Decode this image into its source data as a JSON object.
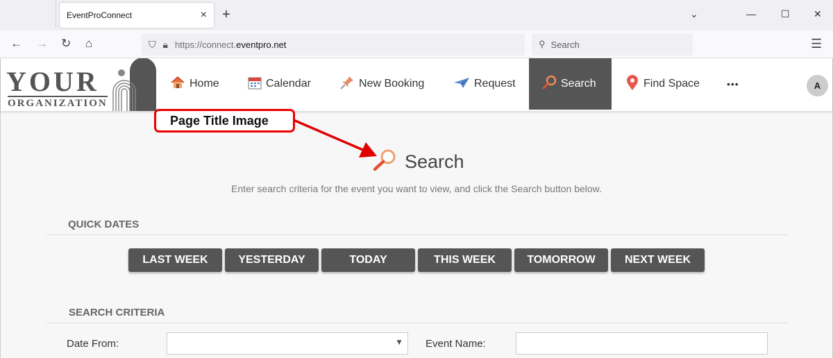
{
  "browser": {
    "tab_title": "EventProConnect",
    "tab_close": "×",
    "new_tab": "+",
    "url_proto": "https://connect.",
    "url_host": "eventpro.net",
    "search_placeholder": "Search",
    "window_controls": [
      "⌄",
      "—",
      "☐",
      "✕"
    ]
  },
  "logo": {
    "line1": "YOUR",
    "line2": "ORGANIZATION"
  },
  "nav": {
    "items": [
      {
        "label": "Home",
        "icon": "home-icon"
      },
      {
        "label": "Calendar",
        "icon": "calendar-icon"
      },
      {
        "label": "New Booking",
        "icon": "pin-icon"
      },
      {
        "label": "Request",
        "icon": "paper-plane-icon"
      },
      {
        "label": "Search",
        "icon": "magnifier-icon",
        "active": true
      },
      {
        "label": "Find Space",
        "icon": "map-pin-icon"
      }
    ],
    "more": "•••",
    "avatar": "A"
  },
  "annotation": {
    "label": "Page Title Image",
    "color": "#e00000"
  },
  "page": {
    "title": "Search",
    "subtitle": "Enter search criteria for the event you want to view, and click the Search button below."
  },
  "quick_dates": {
    "heading": "QUICK DATES",
    "buttons": [
      "LAST WEEK",
      "YESTERDAY",
      "TODAY",
      "THIS WEEK",
      "TOMORROW",
      "NEXT WEEK"
    ]
  },
  "search_criteria": {
    "heading": "SEARCH CRITERIA",
    "date_from_label": "Date From:",
    "date_from_value": "",
    "event_name_label": "Event Name:",
    "event_name_value": ""
  },
  "colors": {
    "nav_active_bg": "#555555",
    "button_bg": "#555555",
    "accent_orange": "#e8693a"
  }
}
